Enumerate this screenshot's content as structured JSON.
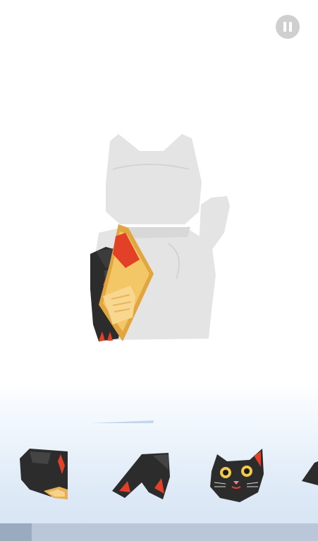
{
  "game": {
    "progress": 0.1,
    "pause_icon": "pause-icon",
    "colors": {
      "ghost": "#e2e2e2",
      "piece_black": "#2b2b2b",
      "accent_red": "#e24128",
      "gold": "#f3c15c",
      "progress_track": "#b9c7d8",
      "progress_fill": "#9aabbf"
    },
    "tray_pieces": [
      "cat-body-piece",
      "cat-ears-piece",
      "cat-head-piece",
      "partial-piece"
    ]
  }
}
